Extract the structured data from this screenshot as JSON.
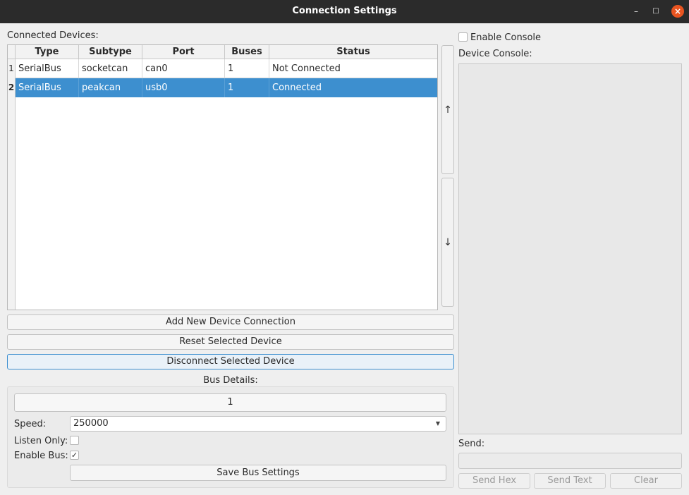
{
  "window": {
    "title": "Connection Settings",
    "minimize_glyph": "–",
    "maximize_glyph": "□",
    "close_glyph": "×",
    "accent": "#e95420"
  },
  "devices": {
    "label": "Connected Devices:",
    "columns": [
      "Type",
      "Subtype",
      "Port",
      "Buses",
      "Status"
    ],
    "rows": [
      {
        "num": "1",
        "type": "SerialBus",
        "subtype": "socketcan",
        "port": "can0",
        "buses": "1",
        "status": "Not Connected"
      },
      {
        "num": "2",
        "type": "SerialBus",
        "subtype": "peakcan",
        "port": "usb0",
        "buses": "1",
        "status": "Connected"
      }
    ],
    "selection_color": "#3d8fcf",
    "move_up": "↑",
    "move_down": "↓"
  },
  "buttons": {
    "add": "Add New Device Connection",
    "reset": "Reset Selected Device",
    "disconnect": "Disconnect Selected Device"
  },
  "bus": {
    "label": "Bus Details:",
    "tab": "1",
    "speed_label": "Speed:",
    "speed_value": "250000",
    "listen_label": "Listen Only:",
    "listen_checked": false,
    "enable_label": "Enable Bus:",
    "enable_checked": true,
    "check_glyph": "✓",
    "save": "Save Bus Settings"
  },
  "console": {
    "enable_label": "Enable Console",
    "enable_checked": false,
    "label": "Device Console:",
    "send_label": "Send:",
    "send_hex": "Send Hex",
    "send_text": "Send Text",
    "clear": "Clear"
  }
}
